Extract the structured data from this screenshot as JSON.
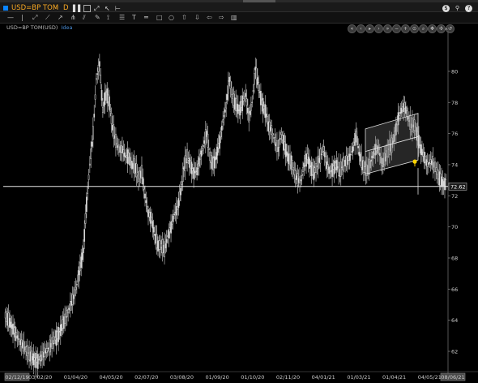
{
  "window": {
    "ric": "USD=BP TOM",
    "period": "D",
    "accent": "#f5a623",
    "brand": "#0a84ff"
  },
  "toolbar_icons": [
    "minus-icon",
    "trendline-icon",
    "ray-icon",
    "arrow-icon",
    "pitchfork-icon",
    "pencil-icon",
    "brush-icon",
    "list-icon",
    "text-icon",
    "horizontal-line-icon",
    "rectangle-icon",
    "ellipse-icon",
    "arrow-up-icon",
    "arrow-down-icon",
    "arrow-left-icon",
    "arrow-right-icon",
    "trash-icon"
  ],
  "chart_header": {
    "instrument": "USD=BP TOM(USD)",
    "idea": "Idea"
  },
  "chart_data": {
    "type": "candlestick",
    "x_ticks": [
      "02/12/19",
      "03/02/20",
      "01/04/20",
      "04/05/20",
      "02/07/20",
      "03/08/20",
      "01/09/20",
      "01/10/20",
      "02/11/20",
      "04/01/21",
      "01/03/21",
      "01/04/21",
      "04/05/21",
      "08/06/21"
    ],
    "y_ticks": [
      62,
      64,
      66,
      68,
      70,
      72,
      74,
      76,
      78,
      80
    ],
    "ylim": [
      60.8,
      82.5
    ],
    "horizontal_line": 72.6,
    "last_price_label": "72.62",
    "price_series": [
      64.3,
      64.0,
      63.6,
      63.2,
      62.8,
      62.5,
      62.2,
      61.9,
      61.6,
      61.5,
      61.4,
      61.6,
      61.9,
      62.1,
      62.4,
      62.7,
      63.0,
      63.4,
      63.9,
      64.4,
      64.9,
      65.5,
      66.3,
      67.4,
      68.5,
      71.5,
      74.0,
      76.0,
      79.5,
      80.5,
      77.5,
      78.7,
      78.0,
      76.4,
      75.5,
      75.0,
      75.0,
      74.5,
      74.6,
      74.0,
      73.8,
      73.2,
      73.5,
      72.0,
      70.9,
      70.5,
      69.5,
      68.8,
      68.8,
      68.5,
      69.4,
      70.0,
      70.8,
      71.2,
      72.3,
      73.8,
      74.5,
      74.0,
      73.5,
      73.6,
      74.5,
      75.2,
      76.0,
      74.5,
      74.0,
      74.6,
      75.5,
      76.8,
      77.8,
      79.5,
      78.3,
      77.8,
      77.5,
      78.0,
      78.5,
      77.0,
      78.0,
      80.2,
      79.0,
      78.0,
      77.5,
      76.5,
      76.2,
      75.5,
      75.0,
      76.0,
      75.2,
      74.5,
      74.2,
      73.5,
      73.0,
      73.0,
      74.0,
      74.5,
      73.9,
      73.5,
      73.9,
      74.5,
      75.0,
      74.0,
      73.5,
      73.8,
      74.0,
      73.5,
      74.0,
      74.2,
      74.5,
      75.0,
      76.0,
      74.7,
      74.0,
      73.5,
      73.8,
      74.5,
      75.0,
      75.0,
      74.0,
      74.5,
      75.0,
      75.2,
      76.0,
      77.0,
      77.5,
      77.8,
      77.0,
      76.5,
      76.5,
      75.8,
      75.0,
      74.5,
      74.0,
      74.2,
      74.0,
      73.5,
      73.0,
      72.8
    ],
    "channel": {
      "upper_start": 76.3,
      "upper_end": 77.3,
      "lower_start": 73.4,
      "lower_end": 74.3
    },
    "marker_value": 74.2,
    "grid": false
  },
  "colors": {
    "background": "#000000",
    "candle": "#d8d8d8",
    "axis_text": "#cccccc",
    "channel_fill": "#8a8a8a",
    "marker": "#ffd400"
  }
}
